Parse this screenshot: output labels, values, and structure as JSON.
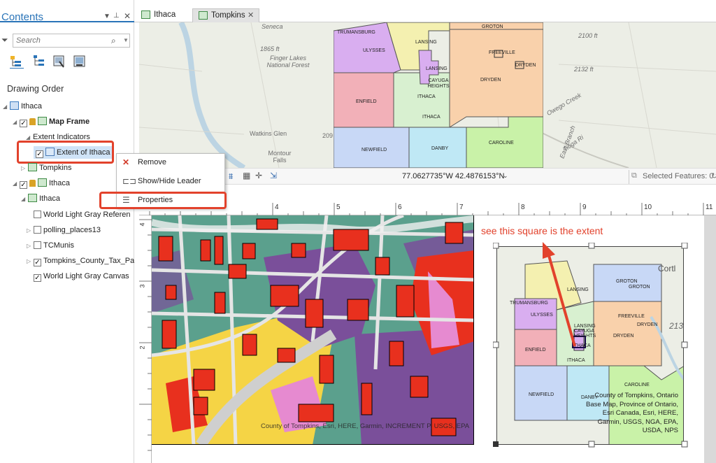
{
  "contents_pane": {
    "title": "Contents",
    "search_placeholder": "Search",
    "drawing_order_label": "Drawing Order",
    "tree": {
      "ithaca_layout": "Ithaca",
      "map_frame": "Map Frame",
      "extent_indicators": "Extent Indicators",
      "extent_of_ithaca": "Extent of Ithaca",
      "tompkins": "Tompkins",
      "ithaca_frame": "Ithaca",
      "ithaca_map": "Ithaca",
      "layers": [
        {
          "label": "World Light Gray Referen",
          "checked": false,
          "expander": false
        },
        {
          "label": "polling_places13",
          "checked": false,
          "expander": true
        },
        {
          "label": "TCMunis",
          "checked": false,
          "expander": true
        },
        {
          "label": "Tompkins_County_Tax_Pa",
          "checked": true,
          "expander": true
        },
        {
          "label": "World Light Gray Canvas",
          "checked": true,
          "expander": false
        }
      ]
    }
  },
  "tabs": [
    {
      "label": "Ithaca",
      "active": false
    },
    {
      "label": "Tompkins",
      "active": true
    }
  ],
  "top_map": {
    "background_labels": [
      "Seneca",
      "1865 ft",
      "Finger Lakes National Forest",
      "Watkins Glen",
      "Montour Falls",
      "2100 ft",
      "2132 ft",
      "209",
      "Tioga Ri",
      "Owego Creek",
      "East Branch"
    ],
    "regions": [
      "TRUMANSBURG",
      "ULYSSES",
      "LANSING",
      "LANSING",
      "CAYUGA HEIGHTS",
      "ITHACA",
      "ITHACA",
      "ENFIELD",
      "GROTON",
      "FREEVILLE",
      "DRYDEN",
      "DRYDEN",
      "NEWFIELD",
      "DANBY",
      "CAROLINE"
    ]
  },
  "status_bar": {
    "coordinates": "77.0627735°W 42.4876153°N",
    "selected_features": "Selected Features: 0"
  },
  "context_menu": {
    "items": [
      "Remove",
      "Show/Hide Leader",
      "Properties"
    ]
  },
  "layout": {
    "ruler_numbers": [
      "4",
      "5",
      "6",
      "7",
      "8",
      "9",
      "10",
      "11"
    ],
    "ruler_left_numbers": [
      "4",
      "3",
      "2"
    ],
    "annotation": "see this square is the extent",
    "attribution_main": "County of Tompkins, Esri, HERE, Garmin, INCREMENT P, USGS, EPA",
    "inset_regions": [
      "Cortl",
      "213",
      "TRUMANSBURG",
      "ULYSSES",
      "LANSING",
      "GROTON",
      "GROTON",
      "FREEVILLE",
      "DRYDEN",
      "DRYDEN",
      "LANSING",
      "CAYUGA",
      "HEIGHTS",
      "ITHACA",
      "ITHACA",
      "ENFIELD",
      "NEWFIELD",
      "DANBY",
      "CAROLINE"
    ],
    "attribution_inset": "County of Tompkins, Ontario Base Map, Province of Ontario, Esri Canada, Esri, HERE, Garmin, USGS, NGA, EPA, USDA, NPS"
  },
  "colors": {
    "accent": "#2a74b8",
    "highlight": "#e2422c",
    "parcel_red": "#e8301e",
    "parcel_teal": "#5ba08d",
    "parcel_purple": "#7a4f9a",
    "parcel_yellow": "#f5d445"
  }
}
